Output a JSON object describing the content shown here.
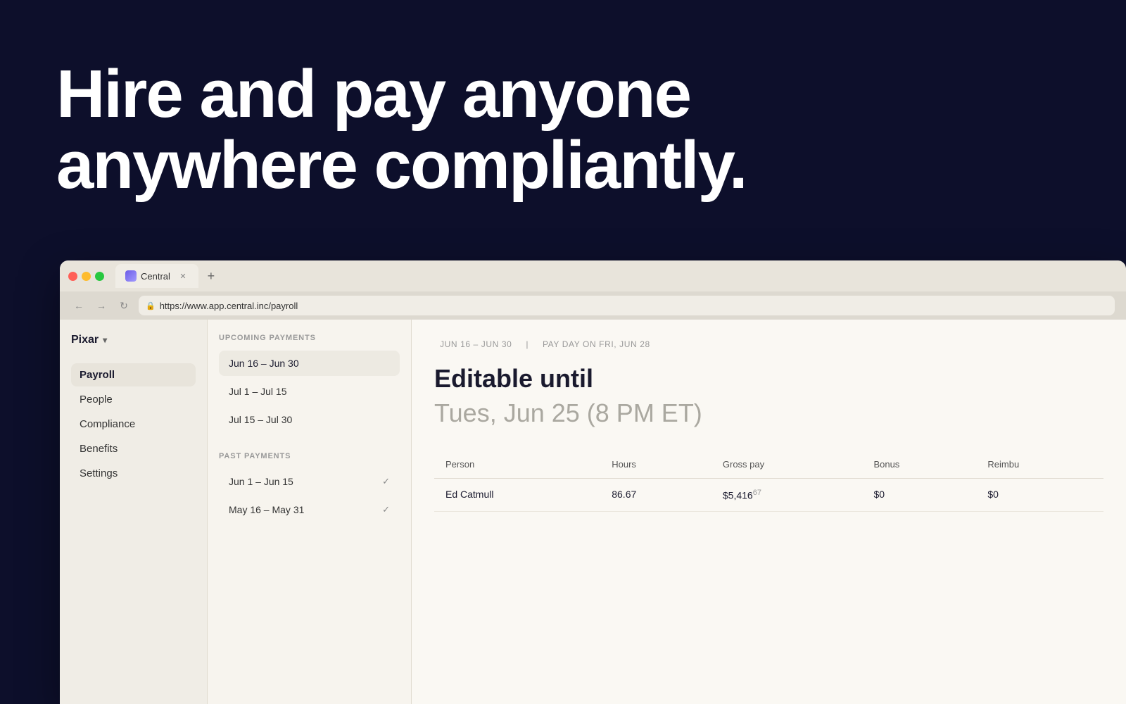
{
  "hero": {
    "line1": "Hire and pay anyone",
    "line2": "anywhere compliantly."
  },
  "browser": {
    "tab_label": "Central",
    "url": "https://www.app.central.inc/payroll",
    "new_tab_label": "+"
  },
  "sidebar": {
    "org_name": "Pixar",
    "nav_items": [
      {
        "label": "Payroll",
        "active": true
      },
      {
        "label": "People",
        "active": false
      },
      {
        "label": "Compliance",
        "active": false
      },
      {
        "label": "Benefits",
        "active": false
      },
      {
        "label": "Settings",
        "active": false
      }
    ]
  },
  "payments_panel": {
    "upcoming_label": "UPCOMING PAYMENTS",
    "upcoming_items": [
      {
        "label": "Jun 16 – Jun 30",
        "active": true
      },
      {
        "label": "Jul 1 – Jul 15",
        "active": false
      },
      {
        "label": "Jul 15 – Jul 30",
        "active": false
      }
    ],
    "past_label": "PAST PAYMENTS",
    "past_items": [
      {
        "label": "Jun 1 – Jun 15",
        "checked": true
      },
      {
        "label": "May 16 – May 31",
        "checked": true
      }
    ]
  },
  "main": {
    "period_range": "JUN 16 – JUN 30",
    "separator": "|",
    "pay_day": "PAY DAY ON FRI, JUN 28",
    "editable_label": "Editable until",
    "editable_date": "Tues, Jun 25 (8 PM ET)",
    "table_headers": [
      "Person",
      "Hours",
      "Gross pay",
      "Bonus",
      "Reimbu"
    ],
    "table_rows": [
      {
        "person": "Ed Catmull",
        "hours": "86.67",
        "gross_pay": "$5,416",
        "gross_pay_super": "67",
        "bonus": "$0",
        "reimbu": "$0"
      }
    ]
  },
  "icons": {
    "lock": "🔒",
    "back": "←",
    "forward": "→",
    "refresh": "↻",
    "check": "✓"
  }
}
